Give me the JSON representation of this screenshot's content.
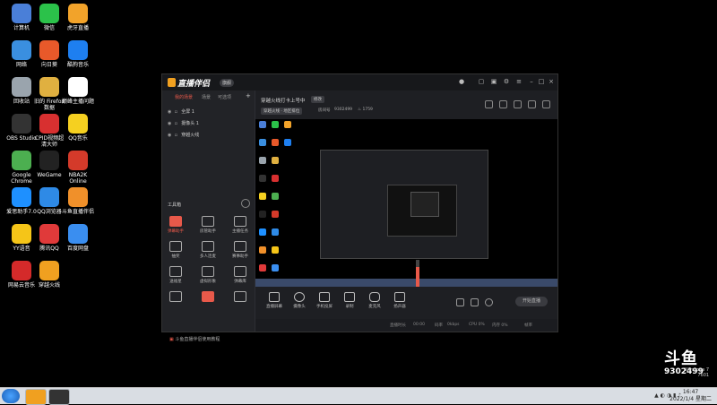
{
  "desktop_icons": [
    {
      "label": "计算机",
      "color": "#4a7fd8",
      "icon": "computer-icon"
    },
    {
      "label": "微信",
      "color": "#2bc24a",
      "icon": "wechat-icon"
    },
    {
      "label": "虎牙直播",
      "color": "#f2a32a",
      "icon": "huya-icon"
    },
    {
      "label": "网络",
      "color": "#3a8fe0",
      "icon": "network-icon"
    },
    {
      "label": "向日葵",
      "color": "#e8592a",
      "icon": "sunflower-icon"
    },
    {
      "label": "酷狗音乐",
      "color": "#1e7ff0",
      "icon": "kugou-icon"
    },
    {
      "label": "回收站",
      "color": "#9aa4ad",
      "icon": "recycle-bin-icon"
    },
    {
      "label": "旧的 Firefox\n数据",
      "color": "#e0b040",
      "icon": "folder-icon"
    },
    {
      "label": "巅峰主播问题",
      "color": "#ffffff",
      "icon": "document-icon"
    },
    {
      "label": "OBS Studio",
      "color": "#333333",
      "icon": "obs-icon"
    },
    {
      "label": "CPID视频超\n清大师",
      "color": "#d83030",
      "icon": "cpid-icon"
    },
    {
      "label": "QQ音乐",
      "color": "#f5d020",
      "icon": "qq-music-icon"
    },
    {
      "label": "Google\nChrome",
      "color": "#4caf50",
      "icon": "chrome-icon"
    },
    {
      "label": "WeGame",
      "color": "#222222",
      "icon": "wegame-icon"
    },
    {
      "label": "NBA2K\nOnline",
      "color": "#d43a2a",
      "icon": "nba2k-icon"
    },
    {
      "label": "爱思助手7.0",
      "color": "#1e90ff",
      "icon": "i4-icon"
    },
    {
      "label": "QQ浏览器",
      "color": "#2e8ae6",
      "icon": "qq-browser-icon"
    },
    {
      "label": "斗鱼直播伴侣",
      "color": "#f0902a",
      "icon": "douyu-icon"
    },
    {
      "label": "YY语音",
      "color": "#f5c518",
      "icon": "yy-icon"
    },
    {
      "label": "腾讯QQ",
      "color": "#e03a3a",
      "icon": "qq-icon"
    },
    {
      "label": "百度网盘",
      "color": "#3a8ef0",
      "icon": "baidu-pan-icon"
    },
    {
      "label": "网易云音乐",
      "color": "#d42a2a",
      "icon": "netease-music-icon"
    },
    {
      "label": "穿越火线",
      "color": "#f0a020",
      "icon": "crossfire-icon"
    }
  ],
  "app": {
    "name": "直播伴侣",
    "version_badge": "旗舰",
    "left_tabs": [
      "我的场景",
      "场景",
      "可选项"
    ],
    "sources": [
      "全屏 1",
      "摄像头 1",
      "穿越火线"
    ],
    "tools_title": "工具箱",
    "tools": [
      "弹幕助手",
      "房管助手",
      "主播任务",
      "抽奖",
      "多人连麦",
      "赛事助手",
      "送福星",
      "虚拟形象",
      "弹幕库",
      "",
      "",
      ""
    ],
    "notice": "斗鱼直播伴侣使用教程",
    "room_title": "穿越火线打卡上号中",
    "edit_label": "修改",
    "category": "穿越火线 · 地区排位",
    "meta1": "房间号",
    "room_id": "9302499",
    "fans": "1759",
    "volume_value": "75",
    "controls": [
      "直播屏幕",
      "摄像头",
      "手机投屏",
      "录制",
      "麦克风",
      "扬声器"
    ],
    "go_live": "开始直播",
    "status": [
      "直播时长",
      "00:00",
      "码率",
      "0kbps",
      "CPU 0%",
      "内存 0%",
      "帧率"
    ]
  },
  "watermark": {
    "logo": "斗鱼",
    "room_id": "9302499"
  },
  "os": {
    "edition": "Windows 7",
    "build": "7601",
    "time": "16:47",
    "date": "2022/1/4 星期二"
  },
  "colors": {
    "accent": "#e8594a",
    "window_bg": "#1e1f23",
    "sidebar_bg": "#222327",
    "titlebar_bg": "#17181b",
    "douyu_orange": "#f0a020"
  }
}
